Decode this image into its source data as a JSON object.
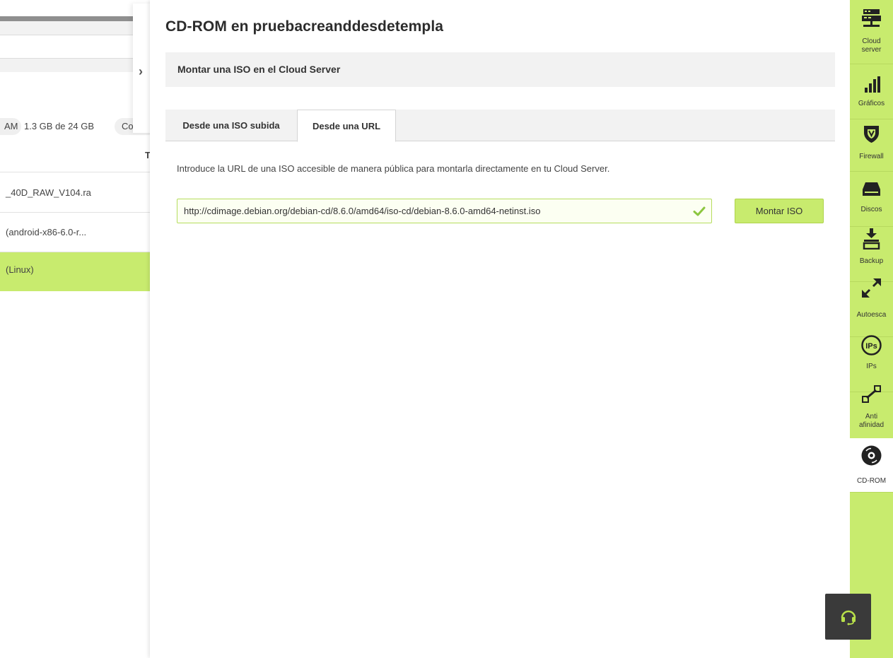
{
  "background_page": {
    "ram_label": "AM",
    "ram_value": "1.3 GB de 24 GB",
    "next_label": "Co",
    "column_header": "T",
    "rows": [
      {
        "text": "_40D_RAW_V104.ra"
      },
      {
        "text": "(android-x86-6.0-r..."
      },
      {
        "text": "(Linux)"
      }
    ]
  },
  "panel": {
    "title": "CD-ROM en pruebacreanddesdetempla",
    "section_title": "Montar una ISO en el Cloud Server",
    "tabs": [
      {
        "label": "Desde una ISO subida",
        "active": false
      },
      {
        "label": "Desde una URL",
        "active": true
      }
    ],
    "intro": "Introduce la URL de una ISO accesible de manera pública para montarla directamente en tu Cloud Server.",
    "url_value": "http://cdimage.debian.org/debian-cd/8.6.0/amd64/iso-cd/debian-8.6.0-amd64-netinst.iso",
    "mount_button": "Montar ISO"
  },
  "sidebar": {
    "items": [
      {
        "label_line1": "Cloud",
        "label_line2": "server",
        "icon": "server-icon"
      },
      {
        "label_line1": "Gráficos",
        "label_line2": "",
        "icon": "bar-chart-icon"
      },
      {
        "label_line1": "Firewall",
        "label_line2": "",
        "icon": "shield-icon"
      },
      {
        "label_line1": "Discos",
        "label_line2": "",
        "icon": "disk-icon"
      },
      {
        "label_line1": "Backup",
        "label_line2": "",
        "icon": "download-tray-icon"
      },
      {
        "label_line1": "Autoesca",
        "label_line2": "",
        "icon": "resize-arrows-icon"
      },
      {
        "label_line1": "IPs",
        "label_line2": "",
        "icon": "ips-icon"
      },
      {
        "label_line1": "Anti",
        "label_line2": "afinidad",
        "icon": "anti-affinity-icon"
      },
      {
        "label_line1": "CD-ROM",
        "label_line2": "",
        "icon": "cdrom-icon",
        "active": true
      }
    ]
  },
  "colors": {
    "accent": "#c8eb6e",
    "support_bg": "#3a3a3a",
    "support_icon": "#b8e04a"
  }
}
